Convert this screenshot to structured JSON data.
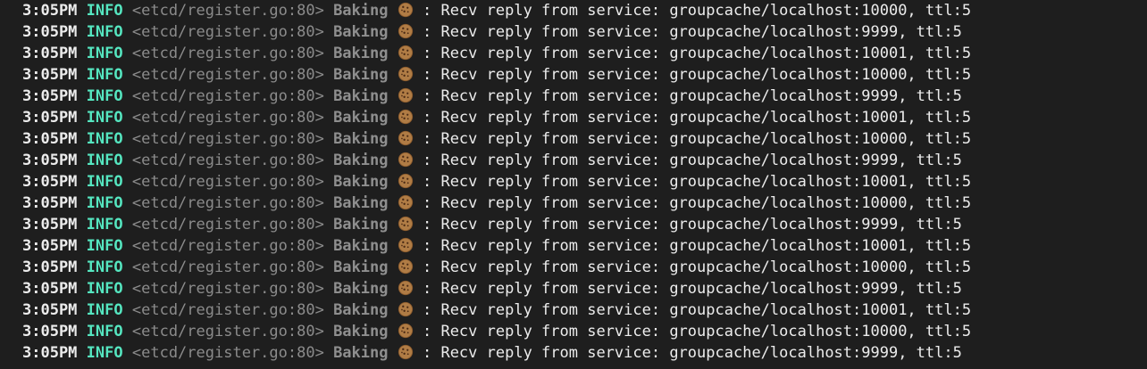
{
  "terminal": {
    "colors": {
      "background": "#1e1e1e",
      "time": "#ececec",
      "level": "#55e6c0",
      "source": "#8b8b8b",
      "tag": "#8f8f8f",
      "message": "#ececec"
    },
    "tag_icon": "cookie-icon",
    "lines": [
      {
        "time": "3:05PM",
        "level": "INFO",
        "source": "<etcd/register.go:80>",
        "tag": "Baking",
        "message": ": Recv reply from service: groupcache/localhost:10000, ttl:5"
      },
      {
        "time": "3:05PM",
        "level": "INFO",
        "source": "<etcd/register.go:80>",
        "tag": "Baking",
        "message": ": Recv reply from service: groupcache/localhost:9999, ttl:5"
      },
      {
        "time": "3:05PM",
        "level": "INFO",
        "source": "<etcd/register.go:80>",
        "tag": "Baking",
        "message": ": Recv reply from service: groupcache/localhost:10001, ttl:5"
      },
      {
        "time": "3:05PM",
        "level": "INFO",
        "source": "<etcd/register.go:80>",
        "tag": "Baking",
        "message": ": Recv reply from service: groupcache/localhost:10000, ttl:5"
      },
      {
        "time": "3:05PM",
        "level": "INFO",
        "source": "<etcd/register.go:80>",
        "tag": "Baking",
        "message": ": Recv reply from service: groupcache/localhost:9999, ttl:5"
      },
      {
        "time": "3:05PM",
        "level": "INFO",
        "source": "<etcd/register.go:80>",
        "tag": "Baking",
        "message": ": Recv reply from service: groupcache/localhost:10001, ttl:5"
      },
      {
        "time": "3:05PM",
        "level": "INFO",
        "source": "<etcd/register.go:80>",
        "tag": "Baking",
        "message": ": Recv reply from service: groupcache/localhost:10000, ttl:5"
      },
      {
        "time": "3:05PM",
        "level": "INFO",
        "source": "<etcd/register.go:80>",
        "tag": "Baking",
        "message": ": Recv reply from service: groupcache/localhost:9999, ttl:5"
      },
      {
        "time": "3:05PM",
        "level": "INFO",
        "source": "<etcd/register.go:80>",
        "tag": "Baking",
        "message": ": Recv reply from service: groupcache/localhost:10001, ttl:5"
      },
      {
        "time": "3:05PM",
        "level": "INFO",
        "source": "<etcd/register.go:80>",
        "tag": "Baking",
        "message": ": Recv reply from service: groupcache/localhost:10000, ttl:5"
      },
      {
        "time": "3:05PM",
        "level": "INFO",
        "source": "<etcd/register.go:80>",
        "tag": "Baking",
        "message": ": Recv reply from service: groupcache/localhost:9999, ttl:5"
      },
      {
        "time": "3:05PM",
        "level": "INFO",
        "source": "<etcd/register.go:80>",
        "tag": "Baking",
        "message": ": Recv reply from service: groupcache/localhost:10001, ttl:5"
      },
      {
        "time": "3:05PM",
        "level": "INFO",
        "source": "<etcd/register.go:80>",
        "tag": "Baking",
        "message": ": Recv reply from service: groupcache/localhost:10000, ttl:5"
      },
      {
        "time": "3:05PM",
        "level": "INFO",
        "source": "<etcd/register.go:80>",
        "tag": "Baking",
        "message": ": Recv reply from service: groupcache/localhost:9999, ttl:5"
      },
      {
        "time": "3:05PM",
        "level": "INFO",
        "source": "<etcd/register.go:80>",
        "tag": "Baking",
        "message": ": Recv reply from service: groupcache/localhost:10001, ttl:5"
      },
      {
        "time": "3:05PM",
        "level": "INFO",
        "source": "<etcd/register.go:80>",
        "tag": "Baking",
        "message": ": Recv reply from service: groupcache/localhost:10000, ttl:5"
      },
      {
        "time": "3:05PM",
        "level": "INFO",
        "source": "<etcd/register.go:80>",
        "tag": "Baking",
        "message": ": Recv reply from service: groupcache/localhost:9999, ttl:5"
      }
    ]
  }
}
